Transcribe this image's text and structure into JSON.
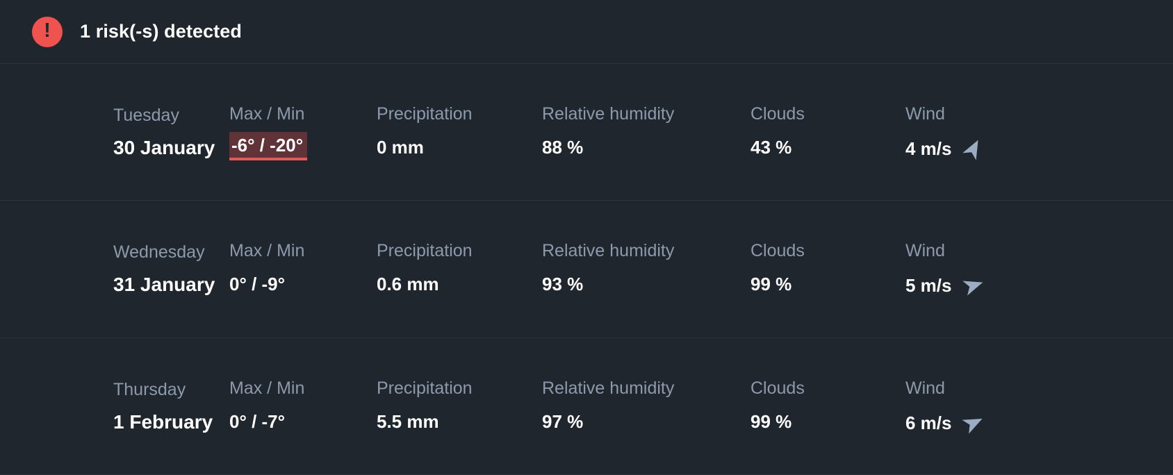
{
  "alert": {
    "icon": "alert-exclamation-icon",
    "text": "1 risk(-s) detected",
    "icon_color": "#ef5350"
  },
  "columns": {
    "max_min": "Max / Min",
    "precipitation": "Precipitation",
    "humidity": "Relative humidity",
    "clouds": "Clouds",
    "wind": "Wind"
  },
  "colors": {
    "background": "#1f262e",
    "label": "#8c9aab",
    "value": "#ffffff",
    "risk_highlight_bg": "#5f3338",
    "risk_underline": "#e0595b",
    "wind_arrow": "#9aadc2",
    "divider": "#2c343d"
  },
  "days": [
    {
      "weekday": "Tuesday",
      "date": "30 January",
      "max_min": "-6° / -20°",
      "max_min_risk": true,
      "precipitation": "0 mm",
      "humidity": "88 %",
      "clouds": "43 %",
      "wind": "4 m/s",
      "wind_direction_deg": 28
    },
    {
      "weekday": "Wednesday",
      "date": "31 January",
      "max_min": "0° / -9°",
      "max_min_risk": false,
      "precipitation": "0.6 mm",
      "humidity": "93 %",
      "clouds": "99 %",
      "wind": "5 m/s",
      "wind_direction_deg": 72
    },
    {
      "weekday": "Thursday",
      "date": "1 February",
      "max_min": "0° / -7°",
      "max_min_risk": false,
      "precipitation": "5.5 mm",
      "humidity": "97 %",
      "clouds": "99 %",
      "wind": "6 m/s",
      "wind_direction_deg": 64
    }
  ]
}
